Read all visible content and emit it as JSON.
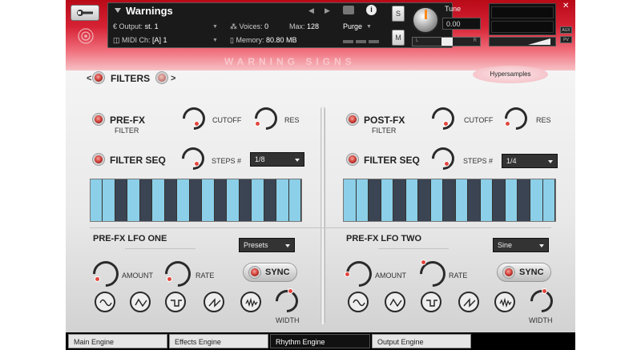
{
  "header": {
    "instrument_name": "Warnings",
    "output_label": "Output:",
    "output_value": "st. 1",
    "voices_label": "Voices:",
    "voices_value": "0",
    "max_label": "Max:",
    "max_value": "128",
    "purge_label": "Purge",
    "midi_label": "MIDI Ch:",
    "midi_value": "[A]  1",
    "memory_label": "Memory:",
    "memory_value": "80.80 MB",
    "tune_label": "Tune",
    "tune_value": "0.00",
    "solo_label": "S",
    "mute_label": "M",
    "pan_l": "L",
    "pan_r": "R",
    "aux_label": "AUX",
    "pv_label": "PV",
    "banner_text": "WARNING SIGNS",
    "brand_badge": "Hypersamples"
  },
  "filters": {
    "nav_left": "<",
    "nav_right": ">",
    "title": "FILTERS"
  },
  "left": {
    "filter_title": "PRE-FX",
    "filter_sub": "FILTER",
    "cutoff": "CUTOFF",
    "res": "RES",
    "seq_label": "FILTER SEQ",
    "steps_label": "STEPS #",
    "steps_value": "1/8",
    "steps": [
      1,
      1,
      0,
      1,
      0,
      1,
      0,
      1,
      0,
      1,
      0,
      1,
      0,
      1,
      0,
      1,
      1
    ],
    "lfo_title": "PRE-FX LFO ONE",
    "lfo_select": "Presets",
    "amount": "AMOUNT",
    "rate": "RATE",
    "sync": "SYNC",
    "width": "WIDTH"
  },
  "right": {
    "filter_title": "POST-FX",
    "filter_sub": "FILTER",
    "cutoff": "CUTOFF",
    "res": "RES",
    "seq_label": "FILTER SEQ",
    "steps_label": "STEPS #",
    "steps_value": "1/4",
    "steps": [
      1,
      1,
      0,
      1,
      0,
      1,
      0,
      1,
      0,
      1,
      0,
      1,
      0,
      1,
      0,
      1,
      1
    ],
    "lfo_title": "PRE-FX LFO TWO",
    "lfo_select": "Sine",
    "amount": "AMOUNT",
    "rate": "RATE",
    "sync": "SYNC",
    "width": "WIDTH"
  },
  "tabs": [
    "Main Engine",
    "Effects Engine",
    "Rhythm Engine",
    "Output Engine"
  ],
  "active_tab": "Rhythm Engine",
  "colors": {
    "header_red": "#d52234",
    "led_red": "#d5463f",
    "seq_on": "#8ccfe8",
    "seq_off": "#3b4452"
  }
}
